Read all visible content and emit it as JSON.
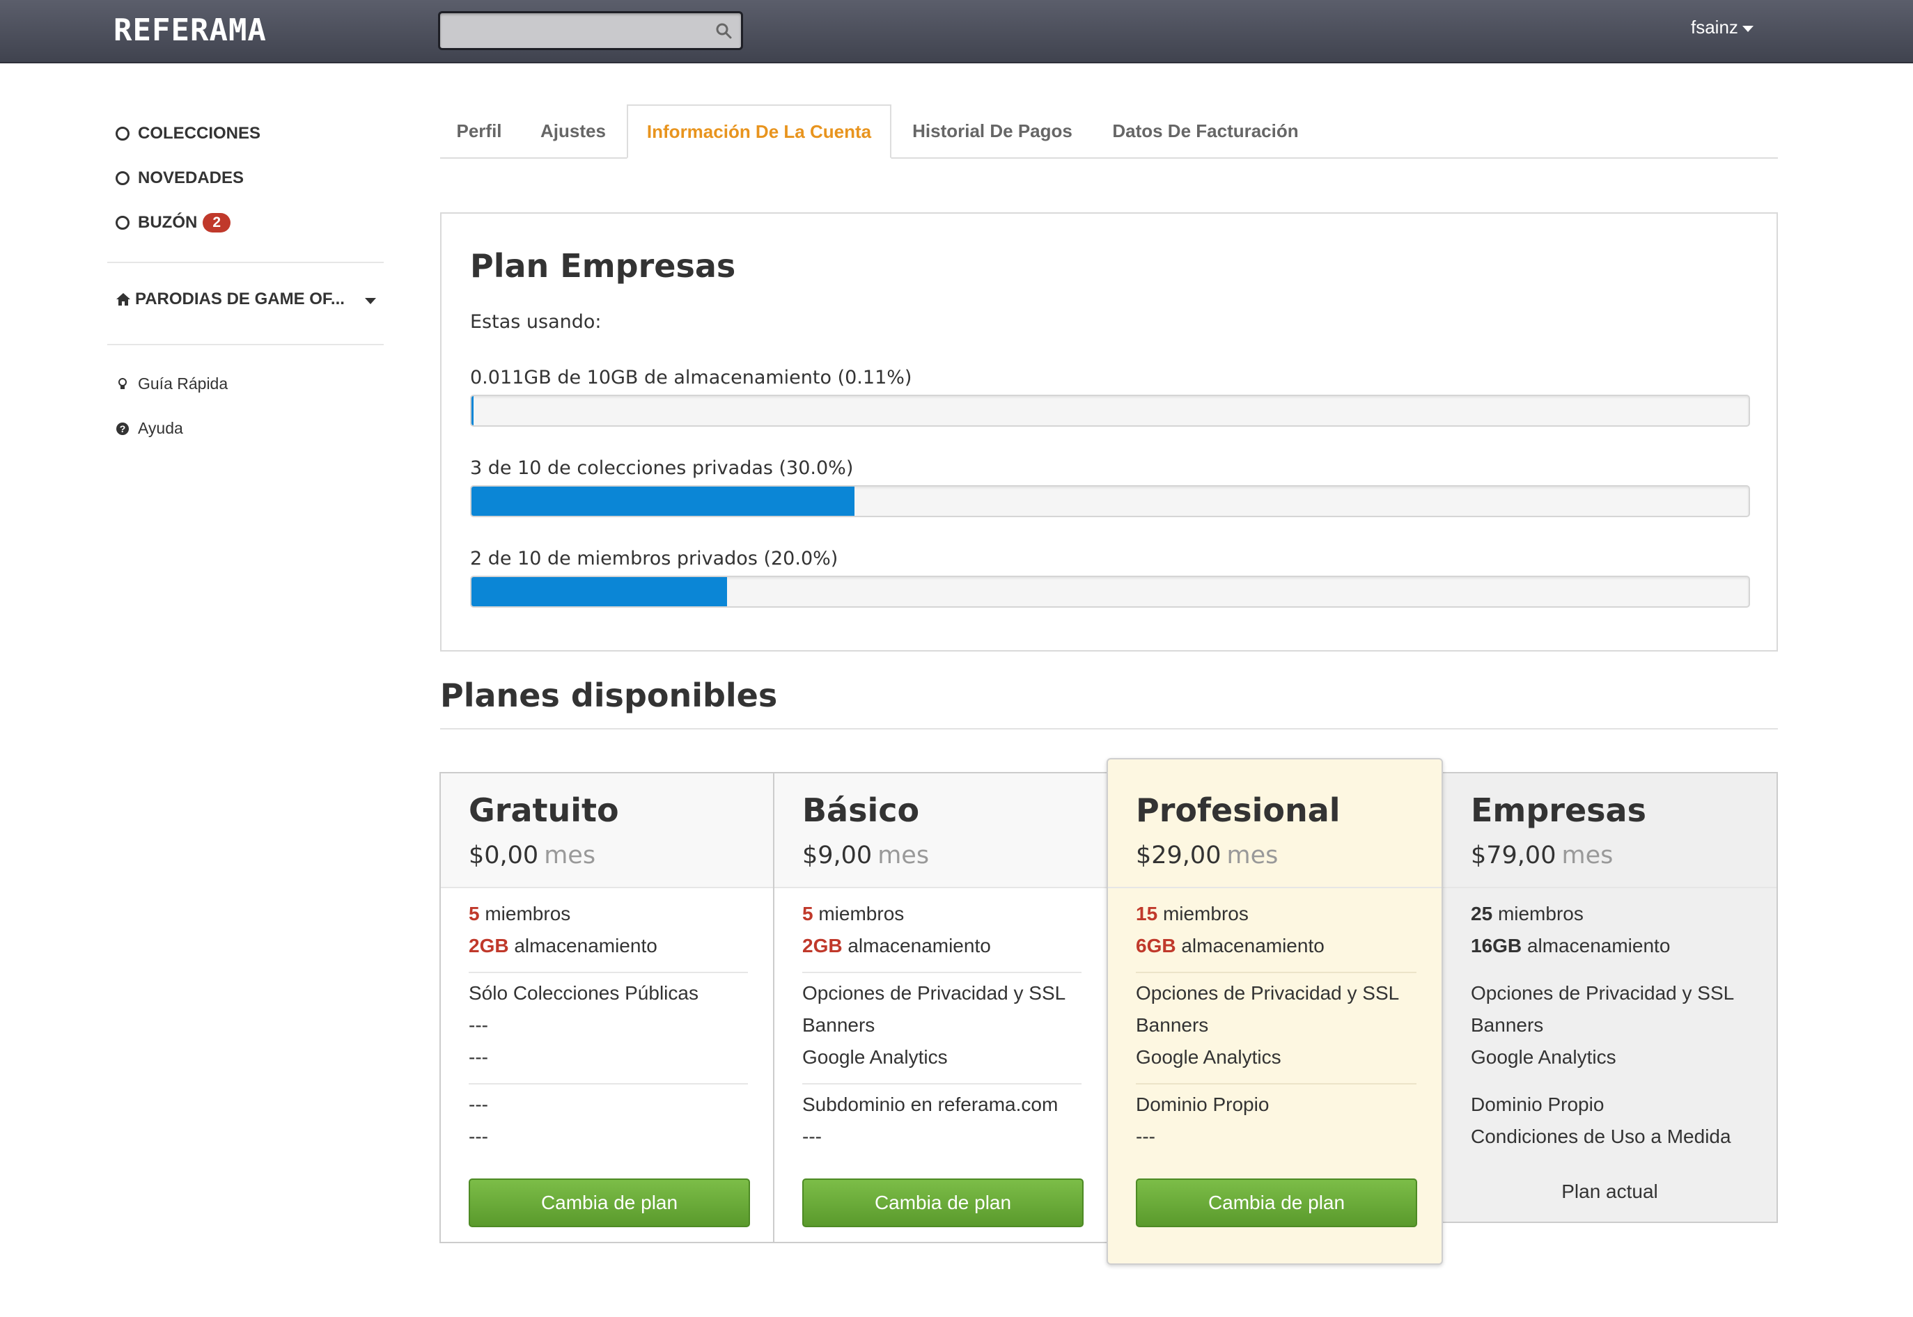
{
  "header": {
    "logo": "REFERAMA",
    "search_placeholder": "",
    "user": "fsainz"
  },
  "sidebar": {
    "items": [
      {
        "label": "COLECCIONES"
      },
      {
        "label": "NOVEDADES"
      },
      {
        "label": "BUZÓN",
        "badge": "2"
      }
    ],
    "collection": "PARODIAS DE GAME OF...",
    "links": [
      {
        "label": "Guía Rápida",
        "icon": "lightbulb-icon"
      },
      {
        "label": "Ayuda",
        "icon": "question-icon"
      }
    ]
  },
  "tabs": [
    {
      "label": "Perfil"
    },
    {
      "label": "Ajustes"
    },
    {
      "label": "Información De La Cuenta",
      "active": true
    },
    {
      "label": "Historial De Pagos"
    },
    {
      "label": "Datos De Facturación"
    }
  ],
  "current_plan": {
    "title": "Plan Empresas",
    "intro": "Estas usando:",
    "usage": [
      {
        "label": "0.011GB de 10GB de almacenamiento (0.11%)",
        "percent": 0.11
      },
      {
        "label": "3 de 10 de colecciones privadas (30.0%)",
        "percent": 30.0
      },
      {
        "label": "2 de 10 de miembros privados (20.0%)",
        "percent": 20.0
      }
    ]
  },
  "plans_section": {
    "title": "Planes disponibles",
    "per_label": "mes",
    "button_label": "Cambia de plan",
    "current_label": "Plan actual",
    "plans": [
      {
        "name": "Gratuito",
        "price": "$0,00",
        "members_num": "5",
        "members_text": "miembros",
        "storage_num": "2GB",
        "storage_text": "almacenamiento",
        "features_a": [
          "Sólo Colecciones Públicas",
          "---",
          "---"
        ],
        "features_b": [
          "---",
          "---"
        ]
      },
      {
        "name": "Básico",
        "price": "$9,00",
        "members_num": "5",
        "members_text": "miembros",
        "storage_num": "2GB",
        "storage_text": "almacenamiento",
        "features_a": [
          "Opciones de Privacidad y SSL",
          "Banners",
          "Google Analytics"
        ],
        "features_b": [
          "Subdominio en referama.com",
          "---"
        ]
      },
      {
        "name": "Profesional",
        "price": "$29,00",
        "members_num": "15",
        "members_text": "miembros",
        "storage_num": "6GB",
        "storage_text": "almacenamiento",
        "features_a": [
          "Opciones de Privacidad y SSL",
          "Banners",
          "Google Analytics"
        ],
        "features_b": [
          "Dominio Propio",
          "---"
        ]
      },
      {
        "name": "Empresas",
        "price": "$79,00",
        "members_num": "25",
        "members_text": "miembros",
        "storage_num": "16GB",
        "storage_text": "almacenamiento",
        "features_a": [
          "Opciones de Privacidad y SSL",
          "Banners",
          "Google Analytics"
        ],
        "features_b": [
          "Dominio Propio",
          "Condiciones de Uso a Medida"
        ]
      }
    ]
  },
  "colors": {
    "accent_tab": "#e8941e",
    "progress": "#0b86d6",
    "highlight_red": "#c0392b",
    "button_green": "#5a9a2c",
    "featured_bg": "#fdf7e1",
    "current_bg": "#efefef"
  }
}
